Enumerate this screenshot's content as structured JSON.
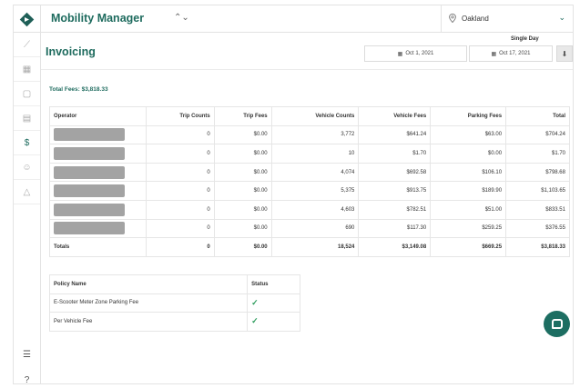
{
  "app": {
    "title": "Mobility Manager",
    "switch_icon": "⌃⌄",
    "city": "Oakland"
  },
  "sidebar": {
    "items": [
      {
        "icon": "chart-icon",
        "glyph": "⟋"
      },
      {
        "icon": "map-icon",
        "glyph": "▦"
      },
      {
        "icon": "copy-icon",
        "glyph": "▢"
      },
      {
        "icon": "list-icon",
        "glyph": "▤"
      },
      {
        "icon": "dollar-icon",
        "glyph": "$"
      },
      {
        "icon": "user-icon",
        "glyph": "☺"
      },
      {
        "icon": "warning-icon",
        "glyph": "△"
      }
    ],
    "bottom": [
      {
        "icon": "settings-sliders-icon",
        "glyph": "☰"
      },
      {
        "icon": "help-icon",
        "glyph": "?"
      }
    ]
  },
  "page": {
    "title": "Invoicing",
    "range_label": "Single Day",
    "date_from": "Oct 1, 2021",
    "date_to": "Oct 17, 2021",
    "total_fees": "Total Fees: $3,818.33"
  },
  "fees_table": {
    "headers": [
      "Operator",
      "Trip Counts",
      "Trip Fees",
      "Vehicle Counts",
      "Vehicle Fees",
      "Parking Fees",
      "Total"
    ],
    "rows": [
      [
        "",
        "0",
        "$0.00",
        "3,772",
        "$641.24",
        "$63.00",
        "$704.24"
      ],
      [
        "",
        "0",
        "$0.00",
        "10",
        "$1.70",
        "$0.00",
        "$1.70"
      ],
      [
        "",
        "0",
        "$0.00",
        "4,074",
        "$692.58",
        "$106.10",
        "$798.68"
      ],
      [
        "",
        "0",
        "$0.00",
        "5,375",
        "$913.75",
        "$189.90",
        "$1,103.65"
      ],
      [
        "",
        "0",
        "$0.00",
        "4,603",
        "$782.51",
        "$51.00",
        "$833.51"
      ],
      [
        "",
        "0",
        "$0.00",
        "690",
        "$117.30",
        "$259.25",
        "$376.55"
      ]
    ],
    "totals": [
      "Totals",
      "0",
      "$0.00",
      "18,524",
      "$3,149.08",
      "$669.25",
      "$3,818.33"
    ]
  },
  "policy_table": {
    "headers": [
      "Policy Name",
      "Status"
    ],
    "rows": [
      {
        "name": "E-Scooter Meter Zone Parking Fee",
        "status": "✓"
      },
      {
        "name": "Per Vehicle Fee",
        "status": "✓"
      }
    ]
  },
  "colors": {
    "brand": "#1e6b5e",
    "check": "#2e9d5e"
  }
}
